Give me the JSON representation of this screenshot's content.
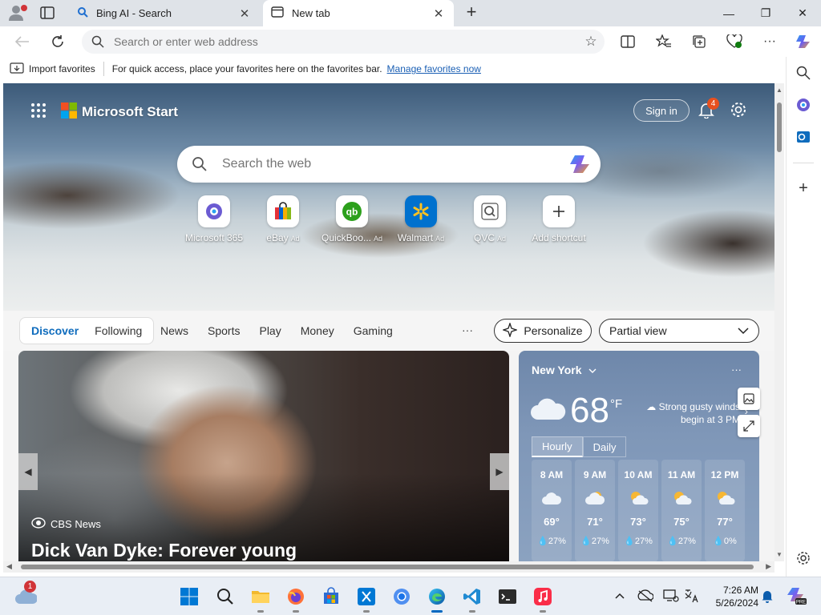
{
  "browser": {
    "tabs": [
      {
        "title": "Bing AI - Search",
        "icon": "bing-search-icon"
      },
      {
        "title": "New tab",
        "icon": "newtab-page-icon"
      }
    ],
    "address": {
      "placeholder": "Search or enter web address",
      "value": ""
    },
    "favorites_bar": {
      "import_label": "Import favorites",
      "message": "For quick access, place your favorites here on the favorites bar.",
      "manage_link": "Manage favorites now"
    }
  },
  "page": {
    "brand": "Microsoft Start",
    "sign_in": "Sign in",
    "notifications_count": "4",
    "search": {
      "placeholder": "Search the web"
    },
    "shortcuts": [
      {
        "label": "Microsoft 365",
        "ad": "",
        "icon": "microsoft365-icon"
      },
      {
        "label": "eBay",
        "ad": "Ad",
        "icon": "ebay-bag-icon"
      },
      {
        "label": "QuickBoo...",
        "ad": "Ad",
        "icon": "quickbooks-icon"
      },
      {
        "label": "Walmart",
        "ad": "Ad",
        "icon": "walmart-spark-icon"
      },
      {
        "label": "QVC",
        "ad": "Ad",
        "icon": "qvc-icon"
      },
      {
        "label": "Add shortcut",
        "ad": "",
        "icon": "plus-icon"
      }
    ],
    "feed_nav": {
      "primary": [
        "Discover",
        "Following"
      ],
      "categories": [
        "News",
        "Sports",
        "Play",
        "Money",
        "Gaming"
      ],
      "more": "···",
      "personalize": "Personalize",
      "view_select": "Partial view"
    },
    "top_story": {
      "source": "CBS News",
      "headline": "Dick Van Dyke: Forever young"
    },
    "weather": {
      "city": "New York",
      "temperature": "68",
      "unit": "°F",
      "alert": "Strong gusty winds begin at 3 PM",
      "tabs": [
        "Hourly",
        "Daily"
      ],
      "hours": [
        {
          "time": "8 AM",
          "temp": "69°",
          "rain": "27%",
          "icon": "cloudy-icon"
        },
        {
          "time": "9 AM",
          "temp": "71°",
          "rain": "27%",
          "icon": "partly-cloudy-icon"
        },
        {
          "time": "10 AM",
          "temp": "73°",
          "rain": "27%",
          "icon": "partly-sunny-icon"
        },
        {
          "time": "11 AM",
          "temp": "75°",
          "rain": "27%",
          "icon": "partly-sunny-icon"
        },
        {
          "time": "12 PM",
          "temp": "77°",
          "rain": "0%",
          "icon": "partly-sunny-icon"
        }
      ]
    }
  },
  "taskbar": {
    "weather_badge": "1",
    "time": "7:26 AM",
    "date": "5/26/2024"
  },
  "colors": {
    "accent": "#0f6cbd",
    "link": "#1a5fb4",
    "badge": "#e8501f"
  }
}
